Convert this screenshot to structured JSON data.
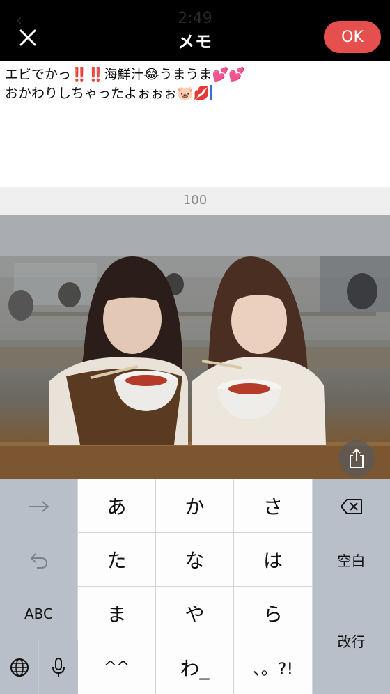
{
  "header": {
    "title": "メモ",
    "ok_label": "OK",
    "ghost_time": "2:49"
  },
  "memo": {
    "line1": "エビでかっ‼️‼️海鮮汁😂うまうま💕💕",
    "line2": "おかわりしちゃったよぉぉぉ🐷💋",
    "char_remaining": "100"
  },
  "keyboard": {
    "rows": [
      [
        "あ",
        "か",
        "さ"
      ],
      [
        "た",
        "な",
        "は"
      ],
      [
        "ま",
        "や",
        "ら"
      ],
      [
        "^^",
        "わ_",
        "、。?!"
      ]
    ],
    "left_keys": [
      "→",
      "↶",
      "ABC"
    ],
    "space_label": "空白",
    "return_label": "改行",
    "icons": {
      "next": "arrow-right-icon",
      "undo": "undo-icon",
      "backspace": "backspace-icon",
      "globe": "globe-icon",
      "mic": "microphone-icon",
      "share": "share-icon",
      "close": "close-icon"
    }
  },
  "colors": {
    "header_bg": "#000000",
    "ok_button": "#e5504f",
    "caret": "#3a6bd8",
    "keyboard_bg": "#d1d5db"
  }
}
